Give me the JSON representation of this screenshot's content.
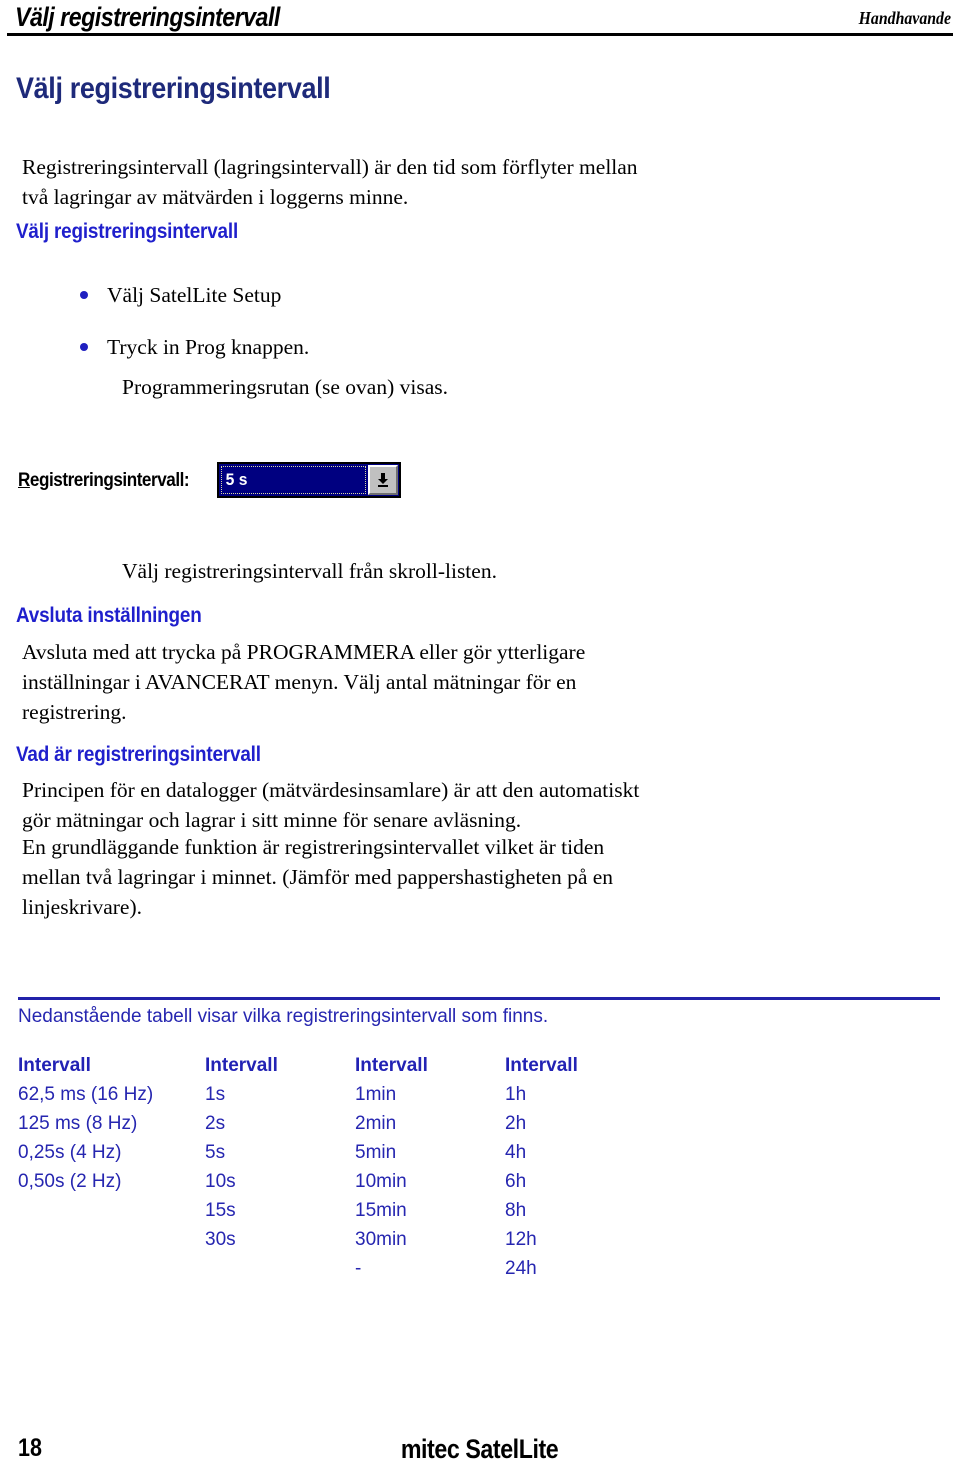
{
  "header": {
    "running_title": "Välj registreringsintervall",
    "section_label": "Handhavande"
  },
  "title": "Välj registreringsintervall",
  "intro": {
    "line1": "Registreringsintervall (lagringsintervall) är den tid som förflyter mellan",
    "line2": "två lagringar av mätvärden i loggerns minne."
  },
  "section_select": {
    "heading": "Välj registreringsintervall",
    "bullets": [
      "Välj SatelLite Setup",
      "Tryck in Prog knappen."
    ],
    "subnote": "Programmeringsrutan (se ovan) visas.",
    "after_shot": "Välj registreringsintervall från skroll-listen."
  },
  "screenshot_widget": {
    "label": "Registreringsintervall:",
    "label_accelerator": "R",
    "label_rest": "egistreringsintervall:",
    "value": "5 s",
    "dropdown_icon": "chevron-down-icon",
    "field_bg": "#000080",
    "button_bg": "#c0c0c0"
  },
  "section_finish": {
    "heading": "Avsluta inställningen",
    "line1": "Avsluta med att trycka på PROGRAMMERA eller gör ytterligare",
    "line2": "inställningar i AVANCERAT menyn. Välj antal mätningar för en",
    "line3": "registrering."
  },
  "section_what": {
    "heading": "Vad är registreringsintervall",
    "p1_line1": "Principen för en datalogger (mätvärdesinsamlare) är att den automatiskt",
    "p1_line2": "gör mätningar och lagrar i sitt minne för senare avläsning.",
    "p2_line1": "En grundläggande funktion är registreringsintervallet vilket är tiden",
    "p2_line2": "mellan två lagringar i minnet. (Jämför med pappershastigheten på en",
    "p2_line3": "linjeskrivare)."
  },
  "table_section": {
    "caption": "Nedanstående tabell visar vilka registreringsintervall som finns.",
    "headers": [
      "Intervall",
      "Intervall",
      "Intervall",
      "Intervall"
    ],
    "rows": [
      [
        "62,5 ms (16 Hz)",
        "1s",
        "1min",
        "1h"
      ],
      [
        "125 ms (8 Hz)",
        "2s",
        "2min",
        "2h"
      ],
      [
        "0,25s (4 Hz)",
        "5s",
        "5min",
        "4h"
      ],
      [
        "0,50s (2 Hz)",
        "10s",
        "10min",
        "6h"
      ],
      [
        "",
        "15s",
        "15min",
        "8h"
      ],
      [
        "",
        "30s",
        "30min",
        "12h"
      ],
      [
        "",
        "",
        "-",
        "24h"
      ]
    ]
  },
  "footer": {
    "page_number": "18",
    "brand": "mitec SatelLite"
  },
  "colors": {
    "title_blue": "#1e2a7a",
    "heading_blue": "#1f1fcc",
    "table_blue": "#2626b0",
    "rule_blue": "#2222aa",
    "rule_black": "#000000"
  }
}
